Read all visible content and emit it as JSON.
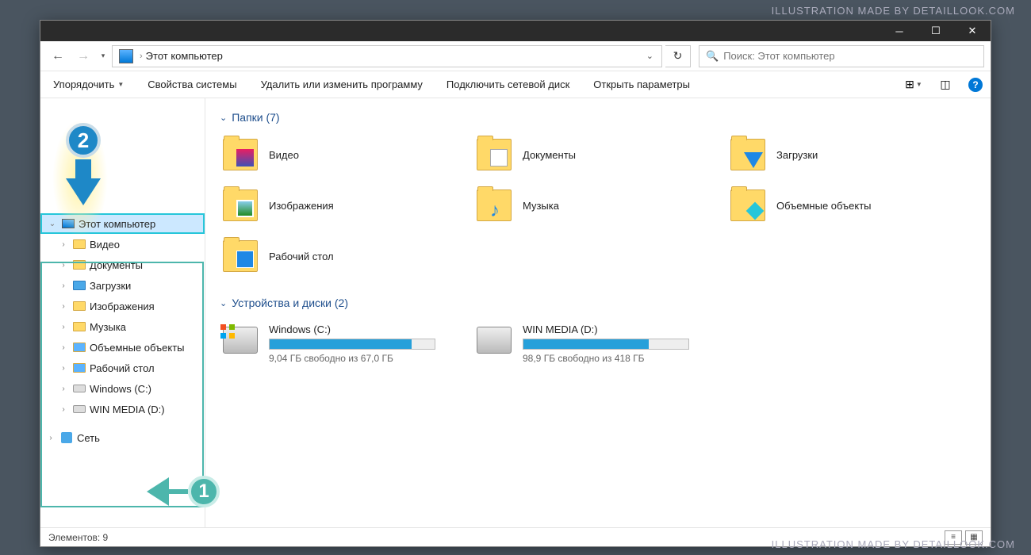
{
  "watermark": "ILLUSTRATION MADE BY DETAILLOOK.COM",
  "breadcrumb": {
    "location": "Этот компьютер"
  },
  "search": {
    "placeholder": "Поиск: Этот компьютер"
  },
  "toolbar": {
    "organize": "Упорядочить",
    "system_props": "Свойства системы",
    "uninstall": "Удалить или изменить программу",
    "map_drive": "Подключить сетевой диск",
    "open_settings": "Открыть параметры"
  },
  "sidebar": {
    "this_pc": "Этот компьютер",
    "items": [
      {
        "label": "Видео"
      },
      {
        "label": "Документы"
      },
      {
        "label": "Загрузки"
      },
      {
        "label": "Изображения"
      },
      {
        "label": "Музыка"
      },
      {
        "label": "Объемные объекты"
      },
      {
        "label": "Рабочий стол"
      },
      {
        "label": "Windows (C:)"
      },
      {
        "label": "WIN MEDIA (D:)"
      }
    ],
    "network": "Сеть"
  },
  "sections": {
    "folders_header": "Папки (7)",
    "drives_header": "Устройства и диски (2)"
  },
  "folders": [
    {
      "label": "Видео"
    },
    {
      "label": "Документы"
    },
    {
      "label": "Загрузки"
    },
    {
      "label": "Изображения"
    },
    {
      "label": "Музыка"
    },
    {
      "label": "Объемные объекты"
    },
    {
      "label": "Рабочий стол"
    }
  ],
  "drives": [
    {
      "name": "Windows (C:)",
      "free": "9,04 ГБ свободно из 67,0 ГБ",
      "fill_pct": 86
    },
    {
      "name": "WIN MEDIA (D:)",
      "free": "98,9 ГБ свободно из 418 ГБ",
      "fill_pct": 76
    }
  ],
  "statusbar": {
    "count": "Элементов: 9"
  },
  "annotations": {
    "one": "1",
    "two": "2"
  }
}
